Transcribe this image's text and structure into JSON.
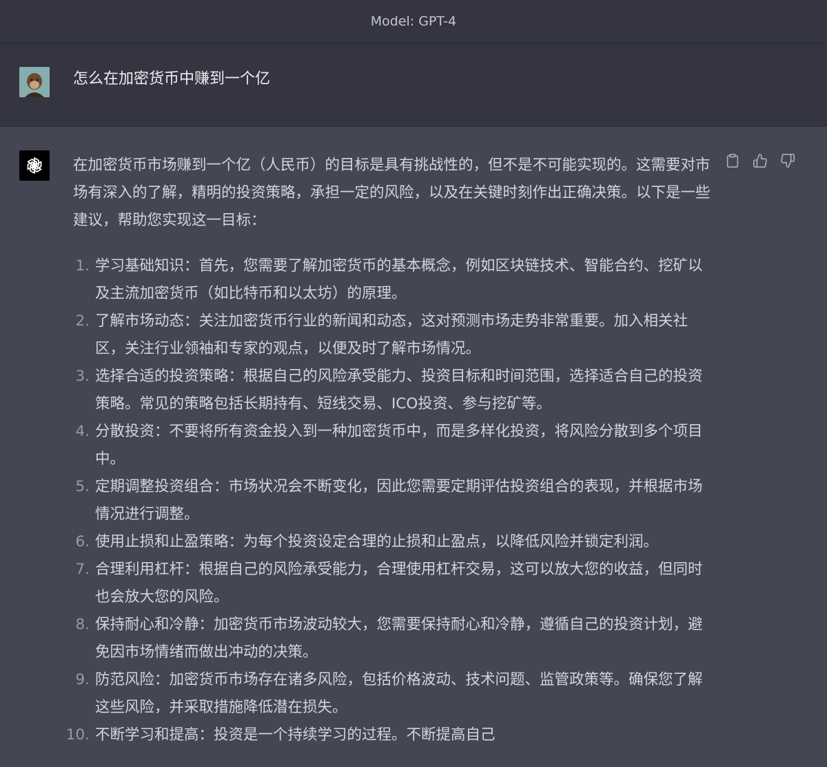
{
  "header": {
    "title": "Model: GPT-4"
  },
  "user_message": {
    "text": "怎么在加密货币中赚到一个亿"
  },
  "assistant_message": {
    "intro": "在加密货币市场赚到一个亿（人民币）的目标是具有挑战性的，但不是不可能实现的。这需要对市场有深入的了解，精明的投资策略，承担一定的风险，以及在关键时刻作出正确决策。以下是一些建议，帮助您实现这一目标：",
    "items": [
      {
        "num": "1.",
        "text": "学习基础知识：首先，您需要了解加密货币的基本概念，例如区块链技术、智能合约、挖矿以及主流加密货币（如比特币和以太坊）的原理。"
      },
      {
        "num": "2.",
        "text": "了解市场动态：关注加密货币行业的新闻和动态，这对预测市场走势非常重要。加入相关社区，关注行业领袖和专家的观点，以便及时了解市场情况。"
      },
      {
        "num": "3.",
        "text": "选择合适的投资策略：根据自己的风险承受能力、投资目标和时间范围，选择适合自己的投资策略。常见的策略包括长期持有、短线交易、ICO投资、参与挖矿等。"
      },
      {
        "num": "4.",
        "text": "分散投资：不要将所有资金投入到一种加密货币中，而是多样化投资，将风险分散到多个项目中。"
      },
      {
        "num": "5.",
        "text": "定期调整投资组合：市场状况会不断变化，因此您需要定期评估投资组合的表现，并根据市场情况进行调整。"
      },
      {
        "num": "6.",
        "text": "使用止损和止盈策略：为每个投资设定合理的止损和止盈点，以降低风险并锁定利润。"
      },
      {
        "num": "7.",
        "text": "合理利用杠杆：根据自己的风险承受能力，合理使用杠杆交易，这可以放大您的收益，但同时也会放大您的风险。"
      },
      {
        "num": "8.",
        "text": "保持耐心和冷静：加密货币市场波动较大，您需要保持耐心和冷静，遵循自己的投资计划，避免因市场情绪而做出冲动的决策。"
      },
      {
        "num": "9.",
        "text": "防范风险：加密货币市场存在诸多风险，包括价格波动、技术问题、监管政策等。确保您了解这些风险，并采取措施降低潜在损失。"
      },
      {
        "num": "10.",
        "text": "不断学习和提高：投资是一个持续学习的过程。不断提高自己"
      }
    ]
  },
  "icons": {
    "avatar": "ape-avatar",
    "assistant": "openai-logo-icon",
    "actions": [
      "copy-icon",
      "thumbs-up-icon",
      "thumbs-down-icon"
    ]
  },
  "colors": {
    "header_bg": "#343541",
    "assistant_bg": "#444654",
    "text": "#d1d5db"
  }
}
